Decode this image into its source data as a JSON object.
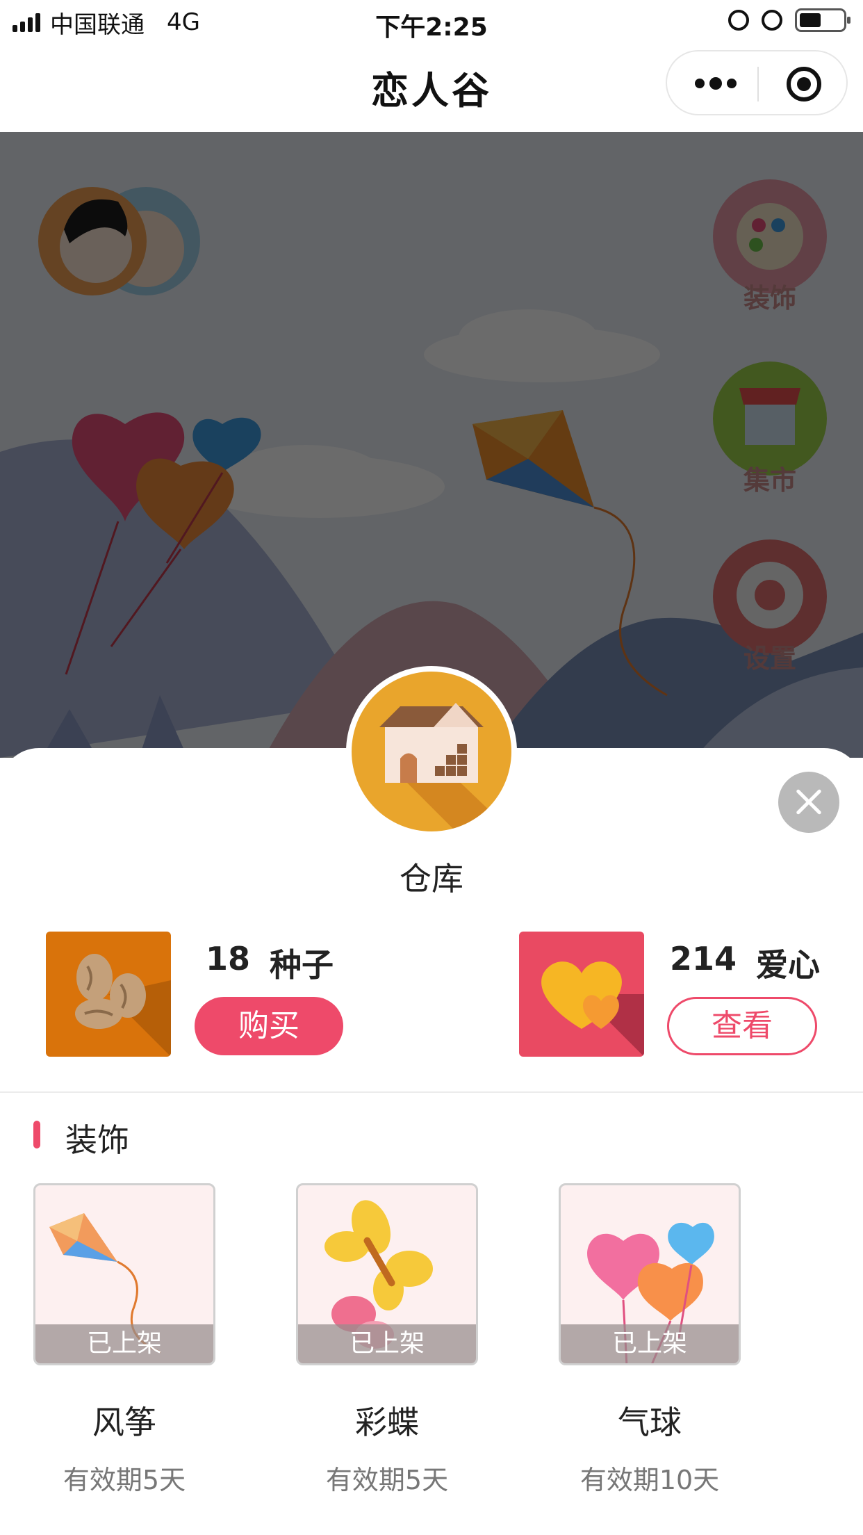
{
  "status_bar": {
    "carrier": "中国联通",
    "network": "4G",
    "time": "下午2:25"
  },
  "nav": {
    "title": "恋人谷"
  },
  "scene": {
    "side_buttons": [
      {
        "label": "装饰",
        "icon": "palette-icon"
      },
      {
        "label": "集市",
        "icon": "market-stall-icon"
      },
      {
        "label": "设置",
        "icon": "gear-icon"
      }
    ]
  },
  "warehouse": {
    "title": "仓库",
    "icon": "house-icon"
  },
  "resources": {
    "seeds": {
      "count": "18",
      "label": "种子",
      "button": "购买",
      "icon": "seeds-icon"
    },
    "hearts": {
      "count": "214",
      "label": "爱心",
      "button": "查看",
      "icon": "hearts-icon"
    }
  },
  "decorations": {
    "section_title": "装饰",
    "items": [
      {
        "name": "风筝",
        "status": "已上架",
        "validity": "有效期5天",
        "icon": "kite-icon"
      },
      {
        "name": "彩蝶",
        "status": "已上架",
        "validity": "有效期5天",
        "icon": "butterfly-icon"
      },
      {
        "name": "气球",
        "status": "已上架",
        "validity": "有效期10天",
        "icon": "balloon-icon"
      }
    ]
  },
  "colors": {
    "accent": "#ee4a6a",
    "warehouse_bg": "#e9a52c",
    "seeds_bg": "#d9730b",
    "hearts_bg": "#e94a62"
  }
}
